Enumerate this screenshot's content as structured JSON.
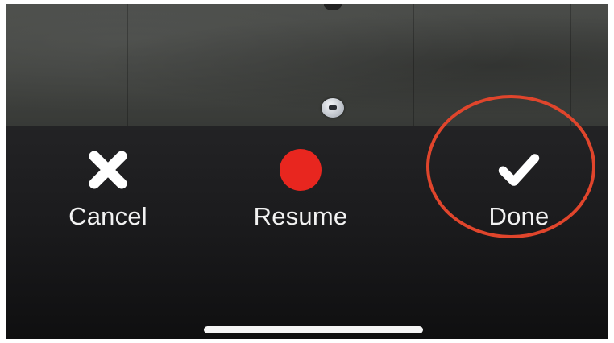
{
  "camera_preview": {
    "subject": "shirt-with-buttons"
  },
  "toolbar": {
    "cancel": {
      "label": "Cancel",
      "icon": "x-close-icon"
    },
    "resume": {
      "label": "Resume",
      "icon": "record-dot-icon",
      "color": "#e8261f"
    },
    "done": {
      "label": "Done",
      "icon": "checkmark-icon"
    }
  },
  "annotation": {
    "highlight_color": "#e0452c",
    "highlighted_item": "done"
  },
  "colors": {
    "toolbar_background": "#1c1c1e",
    "label_text": "#f2f2f2",
    "home_indicator": "#f5f5f5"
  }
}
